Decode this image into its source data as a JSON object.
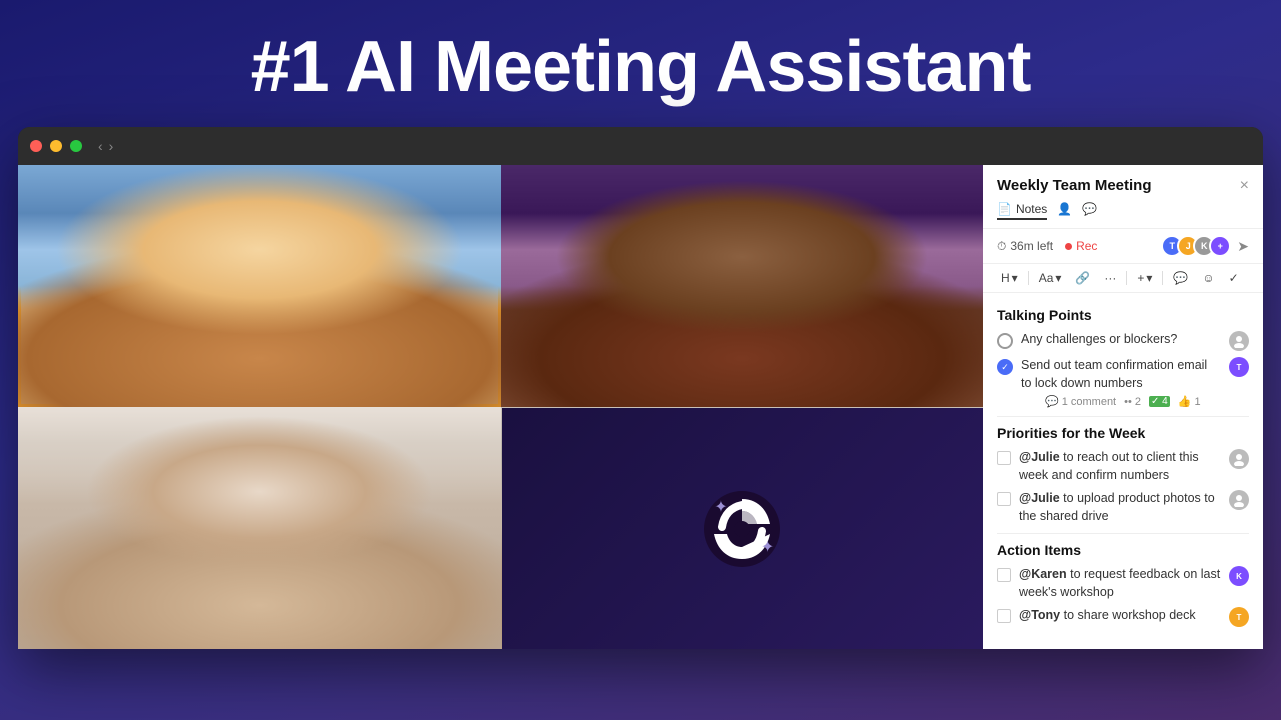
{
  "hero": {
    "title": "#1 AI Meeting Assistant"
  },
  "browser": {
    "nav_back": "‹",
    "nav_forward": "›"
  },
  "panel": {
    "title": "Weekly Team Meeting",
    "close": "×",
    "tabs": [
      {
        "id": "notes",
        "label": "Notes",
        "active": true
      },
      {
        "id": "share",
        "label": ""
      },
      {
        "id": "link",
        "label": ""
      }
    ],
    "time_left": "36m left",
    "rec_label": "Rec",
    "toolbar": {
      "heading": "H",
      "heading_arrow": "▾",
      "font": "Aa",
      "font_arrow": "▾",
      "link": "⌘",
      "more": "···",
      "plus": "+",
      "plus_arrow": "▾",
      "comment_icon": "💬",
      "emoji_icon": "☺",
      "check_icon": "✓"
    },
    "sections": {
      "talking_points": {
        "title": "Talking Points",
        "items": [
          {
            "id": "tp1",
            "text": "Any challenges or blockers?",
            "checked": false,
            "avatar_color": "#bbb",
            "avatar_label": ""
          },
          {
            "id": "tp2",
            "text": "Send out team confirmation email to lock down numbers",
            "checked": true,
            "avatar_color": "#7c4dff",
            "avatar_label": "T",
            "meta": {
              "comments": "1 comment",
              "dots": "•• 2",
              "checks": "✓ 4",
              "thumbs": "👍 1"
            }
          }
        ]
      },
      "priorities": {
        "title": "Priorities for the Week",
        "items": [
          {
            "id": "pr1",
            "mention": "@Julie",
            "text": " to reach out to client this week and confirm numbers",
            "avatar_color": "#bbb",
            "avatar_label": ""
          },
          {
            "id": "pr2",
            "mention": "@Julie",
            "text": " to upload product photos to the shared drive",
            "avatar_color": "#bbb",
            "avatar_label": ""
          }
        ]
      },
      "action_items": {
        "title": "Action Items",
        "items": [
          {
            "id": "ai1",
            "mention": "@Karen",
            "text": " to request feedback on last week's workshop",
            "avatar_color": "#7c4dff",
            "avatar_label": "K"
          },
          {
            "id": "ai2",
            "mention": "@Tony",
            "text": " to share workshop deck",
            "avatar_color": "#f5a623",
            "avatar_label": "T"
          }
        ]
      }
    }
  }
}
